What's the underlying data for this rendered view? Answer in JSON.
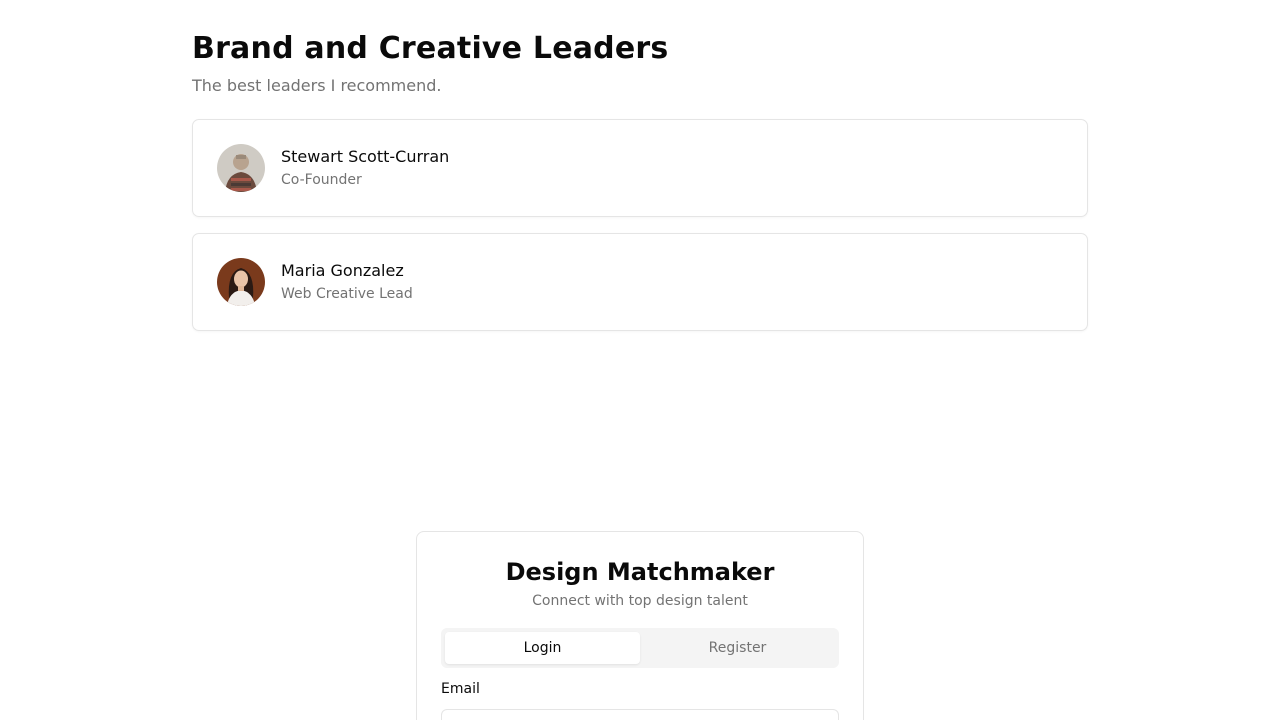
{
  "leaders_section": {
    "title": "Brand and Creative Leaders",
    "subtitle": "The best leaders I recommend.",
    "people": [
      {
        "name": "Stewart Scott-Curran",
        "role": "Co-Founder",
        "avatar_icon": "avatar-photo-man"
      },
      {
        "name": "Maria Gonzalez",
        "role": "Web Creative Lead",
        "avatar_icon": "avatar-photo-woman"
      }
    ]
  },
  "auth": {
    "title": "Design Matchmaker",
    "subtitle": "Connect with top design talent",
    "tabs": [
      {
        "label": "Login",
        "active": true
      },
      {
        "label": "Register",
        "active": false
      }
    ],
    "email_label": "Email",
    "email_value": "",
    "email_placeholder": ""
  },
  "colors": {
    "muted_text": "#737373",
    "border": "#e5e5e5",
    "tab_bg": "#f4f4f4"
  }
}
